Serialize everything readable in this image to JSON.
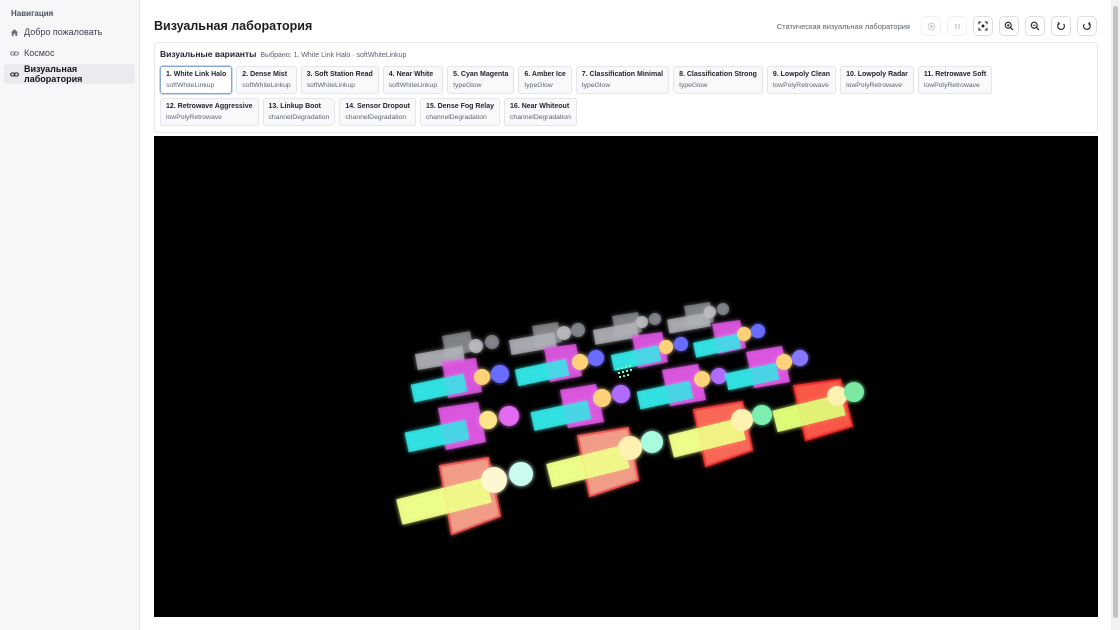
{
  "nav": {
    "title": "Навигация",
    "items": [
      {
        "label": "Добро пожаловать",
        "icon": "home-icon"
      },
      {
        "label": "Космос",
        "icon": "link-icon"
      },
      {
        "label": "Визуальная лаборатория",
        "icon": "link-icon",
        "active": true
      }
    ]
  },
  "header": {
    "title": "Визуальная лаборатория",
    "mode_label": "Статическая визуальная лаборатория",
    "buttons": [
      "record-icon",
      "pause-icon",
      "focus-icon",
      "zoom-in-icon",
      "zoom-out-icon",
      "rotate-left-icon",
      "rotate-right-icon"
    ]
  },
  "variants_panel": {
    "title": "Визуальные варианты",
    "selected_text": "Выбрано: 1. White Link Halo · softWhiteLinkup",
    "variants": [
      {
        "name": "1. White Link Halo",
        "family": "softWhiteLinkup",
        "selected": true
      },
      {
        "name": "2. Dense Mist",
        "family": "softWhiteLinkup"
      },
      {
        "name": "3. Soft Station Read",
        "family": "softWhiteLinkup"
      },
      {
        "name": "4. Near White",
        "family": "softWhiteLinkup"
      },
      {
        "name": "5. Cyan Magenta",
        "family": "typeGlow"
      },
      {
        "name": "6. Amber Ice",
        "family": "typeGlow"
      },
      {
        "name": "7. Classification Minimal",
        "family": "typeGlow"
      },
      {
        "name": "8. Classification Strong",
        "family": "typeGlow"
      },
      {
        "name": "9. Lowpoly Clean",
        "family": "lowPolyRetrowave"
      },
      {
        "name": "10. Lowpoly Radar",
        "family": "lowPolyRetrowave"
      },
      {
        "name": "11. Retrowave Soft",
        "family": "lowPolyRetrowave"
      },
      {
        "name": "12. Retrowave Aggressive",
        "family": "lowPolyRetrowave"
      },
      {
        "name": "13. Linkup Boot",
        "family": "channelDegradation"
      },
      {
        "name": "14. Sensor Dropout",
        "family": "channelDegradation"
      },
      {
        "name": "15. Dense Fog Relay",
        "family": "channelDegradation"
      },
      {
        "name": "16. Near Whiteout",
        "family": "channelDegradation"
      }
    ]
  },
  "colors": {
    "background": "#000000",
    "white_glow": "#e6e9f0",
    "cyan": "#34e6e6",
    "magenta": "#e45ae8",
    "red": "#ff4b4b",
    "salmon": "#f7a08a",
    "yellow_green": "#efff8a",
    "violet": "#8877ff"
  }
}
